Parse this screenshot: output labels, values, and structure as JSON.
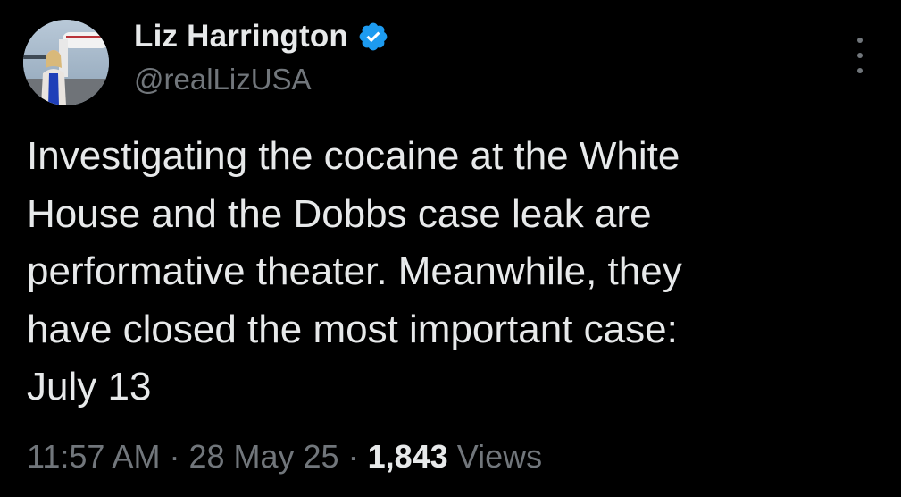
{
  "author": {
    "display_name": "Liz Harrington",
    "handle": "@realLizUSA",
    "verified_icon": "verified-badge-icon",
    "accent_color": "#1d9bf0"
  },
  "tweet": {
    "text": "Investigating the cocaine at the White\nHouse and the Dobbs case leak are\nperformative theater. Meanwhile, they\nhave closed the most important case:\nJuly 13"
  },
  "meta": {
    "time": "11:57 AM",
    "separator": "·",
    "date": "28 May 25",
    "views_count": "1,843",
    "views_label": "Views"
  },
  "more_menu": {
    "icon": "more-options-icon"
  }
}
